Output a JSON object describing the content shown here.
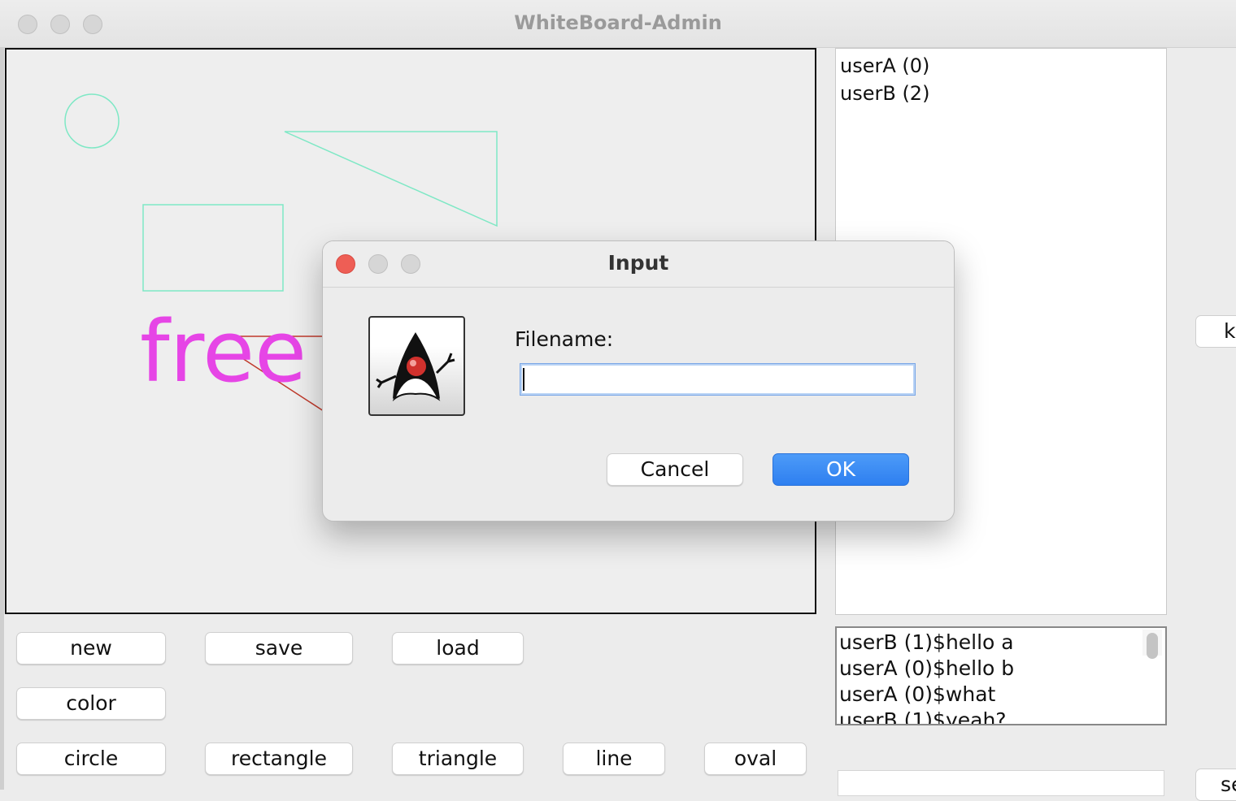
{
  "window": {
    "title": "WhiteBoard-Admin"
  },
  "canvas": {
    "text_item": "free"
  },
  "users": [
    "userA (0)",
    "userB (2)"
  ],
  "chat_messages": [
    "userB (1)$hello a",
    "userA (0)$hello b",
    "userA (0)$what",
    "userB (1)$yeah?"
  ],
  "toolbar": {
    "new": "new",
    "save": "save",
    "load": "load",
    "color": "color",
    "circle": "circle",
    "rectangle": "rectangle",
    "triangle": "triangle",
    "line": "line",
    "oval": "oval"
  },
  "side_buttons": {
    "partial_right_top": "k",
    "partial_right_bottom": "se"
  },
  "dialog": {
    "title": "Input",
    "label": "Filename:",
    "input_value": "",
    "cancel": "Cancel",
    "ok": "OK",
    "icon": "java-duke-icon"
  },
  "colors": {
    "shape_outline": "#7ee8c5",
    "free_text": "#e645e6",
    "line": "#c0392b",
    "accent": "#2e7ff0"
  }
}
